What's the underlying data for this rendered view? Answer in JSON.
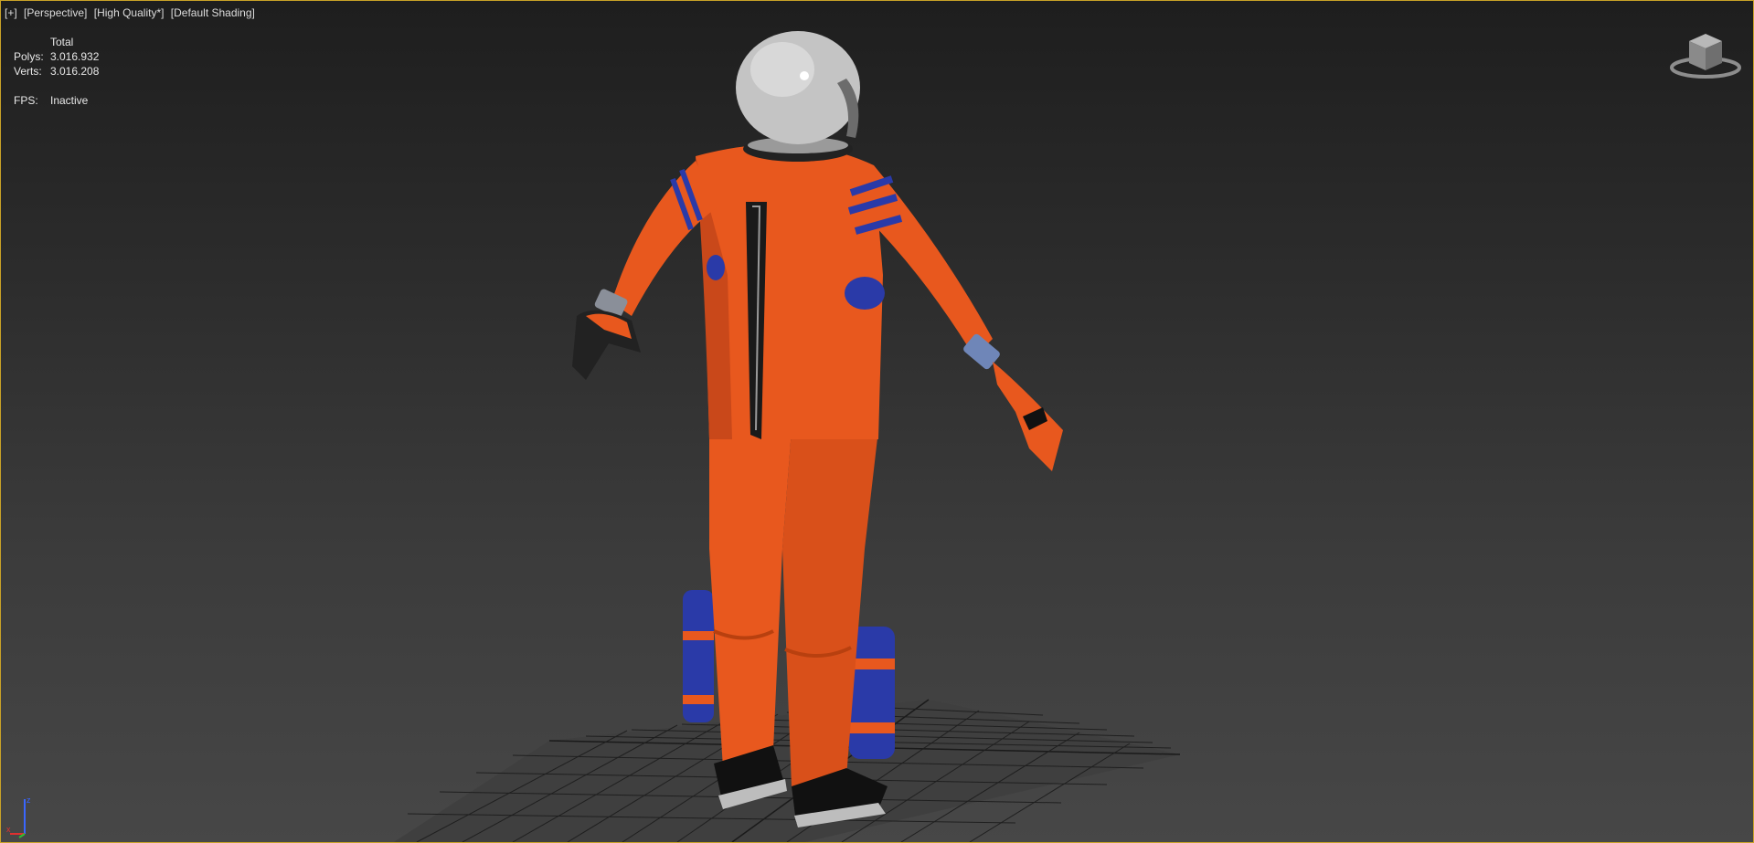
{
  "viewport": {
    "labels": [
      "[+]",
      "[Perspective]",
      "[High Quality*]",
      "[Default Shading]"
    ]
  },
  "stats": {
    "header": "Total",
    "polys_label": "Polys:",
    "polys_value": "3.016.932",
    "verts_label": "Verts:",
    "verts_value": "3.016.208",
    "fps_label": "FPS:",
    "fps_value": "Inactive"
  },
  "viewcube": {
    "icon": "viewcube-icon"
  },
  "axis_tripod": {
    "x": "x",
    "z": "z"
  },
  "colors": {
    "suit": "#e8581e",
    "suit_shadow": "#b8400f",
    "stripe": "#2a3aa8",
    "helmet": "#c8c8c8",
    "grid": "#1c1c1c",
    "border": "#c9a227"
  }
}
